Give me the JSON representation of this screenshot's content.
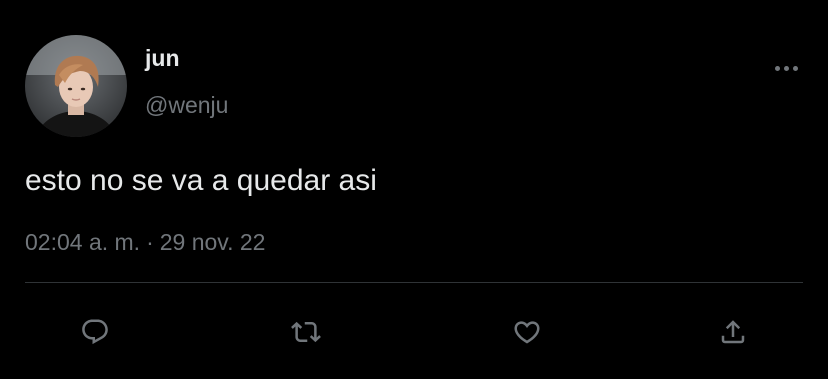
{
  "user": {
    "display_name": "jun",
    "handle": "@wenju",
    "avatar_icon": "profile-photo"
  },
  "tweet": {
    "text": "esto no se va a quedar asi",
    "time": "02:04 a. m.",
    "separator": "·",
    "date": "29 nov. 22"
  },
  "actions": {
    "more_icon": "more-horizontal-icon",
    "reply_icon": "reply-icon",
    "retweet_icon": "retweet-icon",
    "like_icon": "like-icon",
    "share_icon": "share-icon"
  },
  "colors": {
    "background": "#000000",
    "primary_text": "#e7e9ea",
    "secondary_text": "#71767b",
    "divider": "#2f3336"
  }
}
